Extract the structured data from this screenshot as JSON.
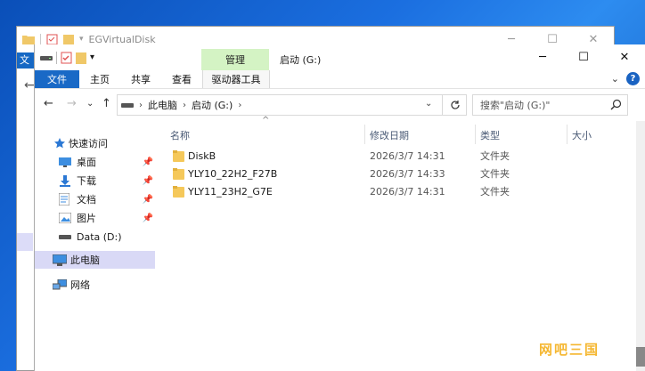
{
  "background_window": {
    "title": "EGVirtualDisk",
    "minimize": "─",
    "maximize": "☐",
    "close": "✕",
    "file_tab_stub": "文"
  },
  "window": {
    "title": "启动 (G:)",
    "context_tab_header": "管理",
    "minimize": "─",
    "maximize": "☐",
    "close": "✕"
  },
  "ribbon": {
    "tabs": [
      {
        "label": "文件"
      },
      {
        "label": "主页"
      },
      {
        "label": "共享"
      },
      {
        "label": "查看"
      },
      {
        "label": "驱动器工具"
      }
    ],
    "collapse": "⌄",
    "help": "?"
  },
  "navbar": {
    "back": "←",
    "forward": "→",
    "recent": "⌄",
    "up": "↑",
    "breadcrumb": [
      "此电脑",
      "启动 (G:)"
    ],
    "search_placeholder": "搜索\"启动 (G:)\""
  },
  "nav_pane": {
    "items": [
      {
        "label": "快速访问",
        "icon": "star-icon"
      },
      {
        "label": "桌面",
        "icon": "desktop-icon",
        "pinned": true
      },
      {
        "label": "下载",
        "icon": "download-icon",
        "pinned": true
      },
      {
        "label": "文档",
        "icon": "document-icon",
        "pinned": true
      },
      {
        "label": "图片",
        "icon": "picture-icon",
        "pinned": true
      },
      {
        "label": "Data (D:)",
        "icon": "drive-icon"
      },
      {
        "label": "此电脑",
        "icon": "computer-icon"
      },
      {
        "label": "网络",
        "icon": "network-icon"
      }
    ]
  },
  "columns": {
    "name": "名称",
    "date": "修改日期",
    "type": "类型",
    "size": "大小"
  },
  "files": [
    {
      "name": "DiskB",
      "date": "2026/3/7 14:31",
      "type": "文件夹",
      "size": ""
    },
    {
      "name": "YLY10_22H2_F27B",
      "date": "2026/3/7 14:33",
      "type": "文件夹",
      "size": ""
    },
    {
      "name": "YLY11_23H2_G7E",
      "date": "2026/3/7 14:31",
      "type": "文件夹",
      "size": ""
    }
  ],
  "watermark": "网吧三国",
  "colors": {
    "accent": "#1969c6",
    "context_tab": "#d4f3c4",
    "selection": "#d9d9f6",
    "folder": "#f5c85a"
  }
}
